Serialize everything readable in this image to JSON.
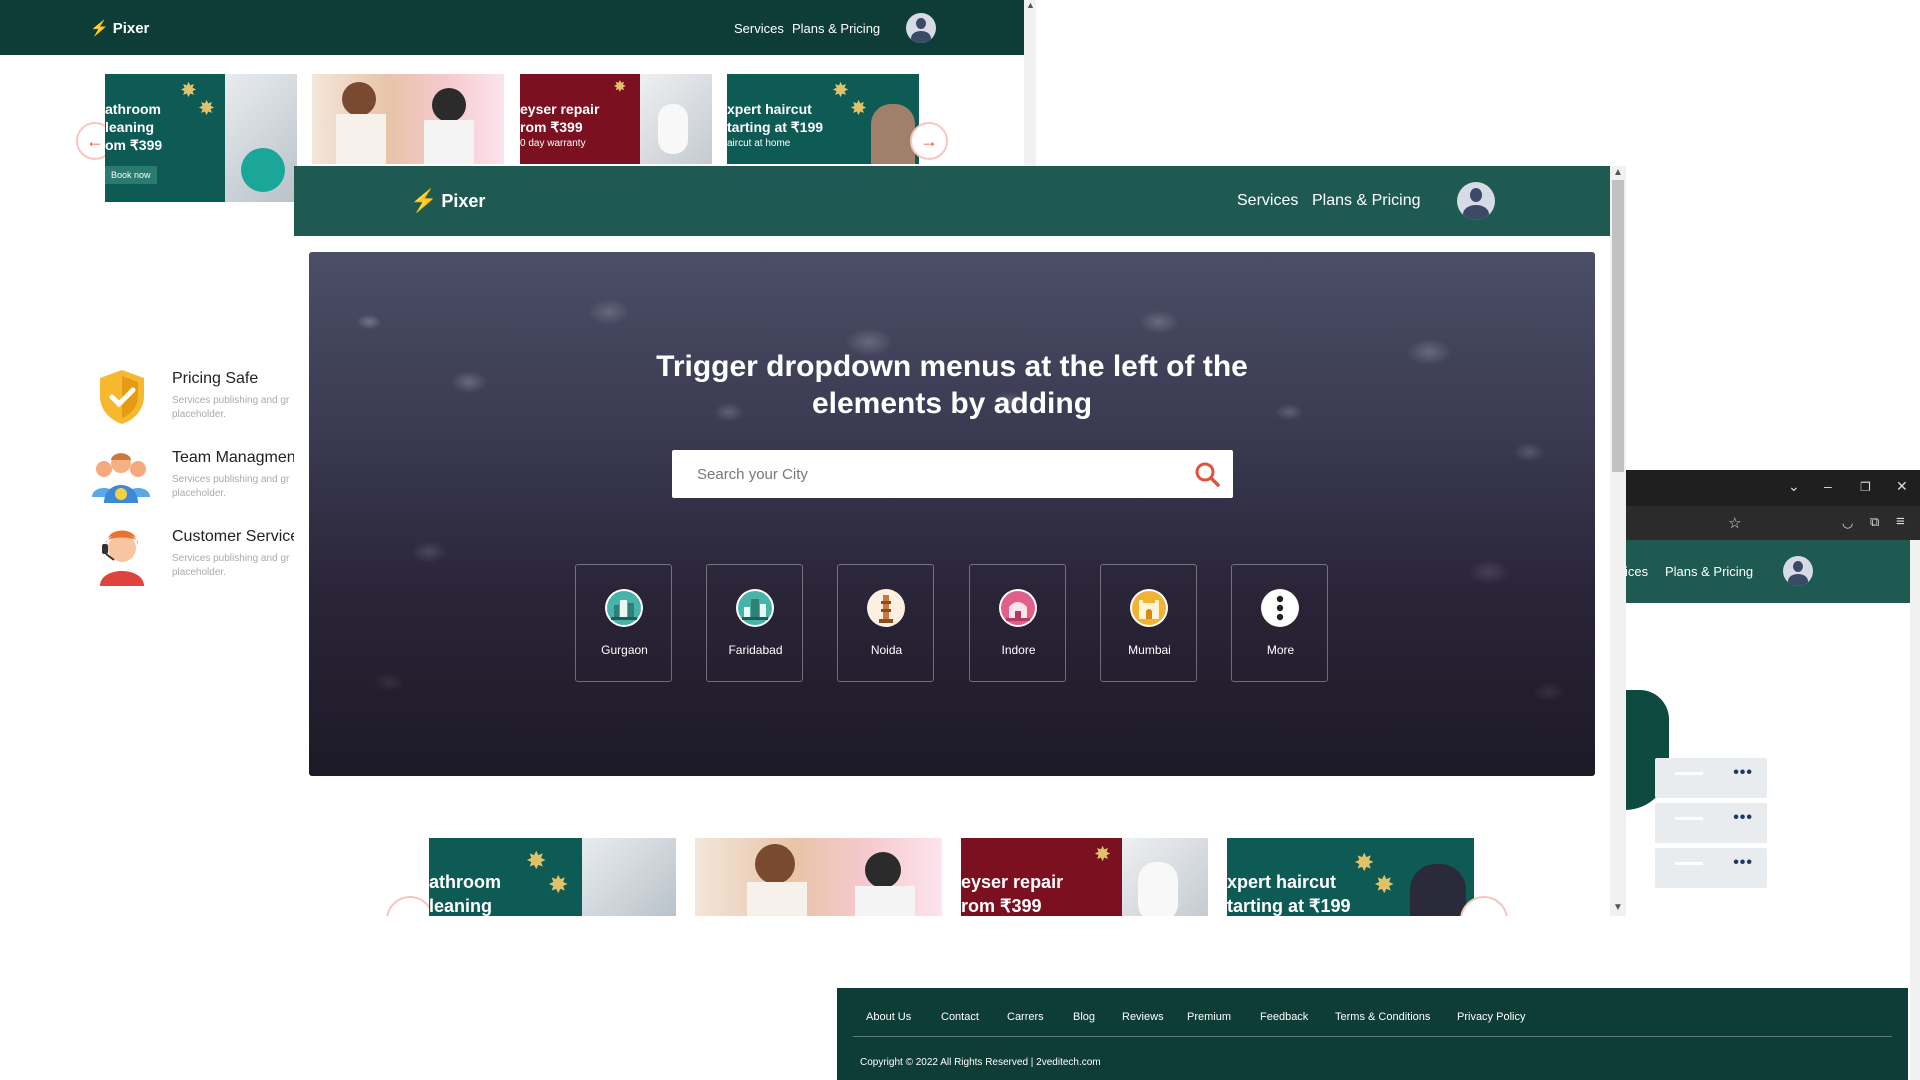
{
  "brand": {
    "name": "Pixer"
  },
  "nav": {
    "services": "Services",
    "plans": "Plans & Pricing"
  },
  "right_nav": {
    "services_partial": "ices",
    "plans": "Plans & Pricing"
  },
  "hero": {
    "title": "Trigger dropdown menus at the left of the elements by adding",
    "search_placeholder": "Search your City"
  },
  "cities": [
    {
      "name": "Gurgaon",
      "icon": "gurgaon-skyline-icon",
      "color": "#48b3a8"
    },
    {
      "name": "Faridabad",
      "icon": "faridabad-skyline-icon",
      "color": "#48b3a8"
    },
    {
      "name": "Noida",
      "icon": "noida-monument-icon",
      "color": "#e8a04a"
    },
    {
      "name": "Indore",
      "icon": "indore-palace-icon",
      "color": "#e0608a"
    },
    {
      "name": "Mumbai",
      "icon": "mumbai-gateway-icon",
      "color": "#f2b233"
    },
    {
      "name": "More",
      "icon": "more-vertical-icon",
      "color": "#222222"
    }
  ],
  "bg_banners": [
    {
      "title": "athroom\nleaning\nom ₹399",
      "button": "Book now"
    },
    {
      "title": ""
    },
    {
      "title": "eyser repair\nrom ₹399",
      "sub": "0 day warranty"
    },
    {
      "title": "xpert haircut\ntarting at ₹199",
      "sub": "aircut at home"
    }
  ],
  "main_banners": [
    {
      "title": "athroom\nleaning"
    },
    {
      "title": ""
    },
    {
      "title": "eyser repair\nrom ₹399"
    },
    {
      "title": "xpert haircut\ntarting at ₹199"
    }
  ],
  "features": [
    {
      "title": "Pricing Safe",
      "desc": "Services publishing and gr placeholder."
    },
    {
      "title": "Team Managmen",
      "desc": "Services publishing and gr placeholder."
    },
    {
      "title": "Customer Service",
      "desc": "Services publishing and gr placeholder."
    }
  ],
  "footer": {
    "links": [
      "About Us",
      "Contact",
      "Carrers",
      "Blog",
      "Reviews",
      "Premium",
      "Feedback",
      "Terms & Conditions",
      "Privacy Policy"
    ],
    "copyright": "Copyright © 2022 All Rights Reserved | 2veditech.com"
  },
  "colors": {
    "nav_dark": "#0d3d36",
    "nav_main": "#1e5a52",
    "accent": "#e0533d",
    "bolt": "#2ecc71"
  }
}
